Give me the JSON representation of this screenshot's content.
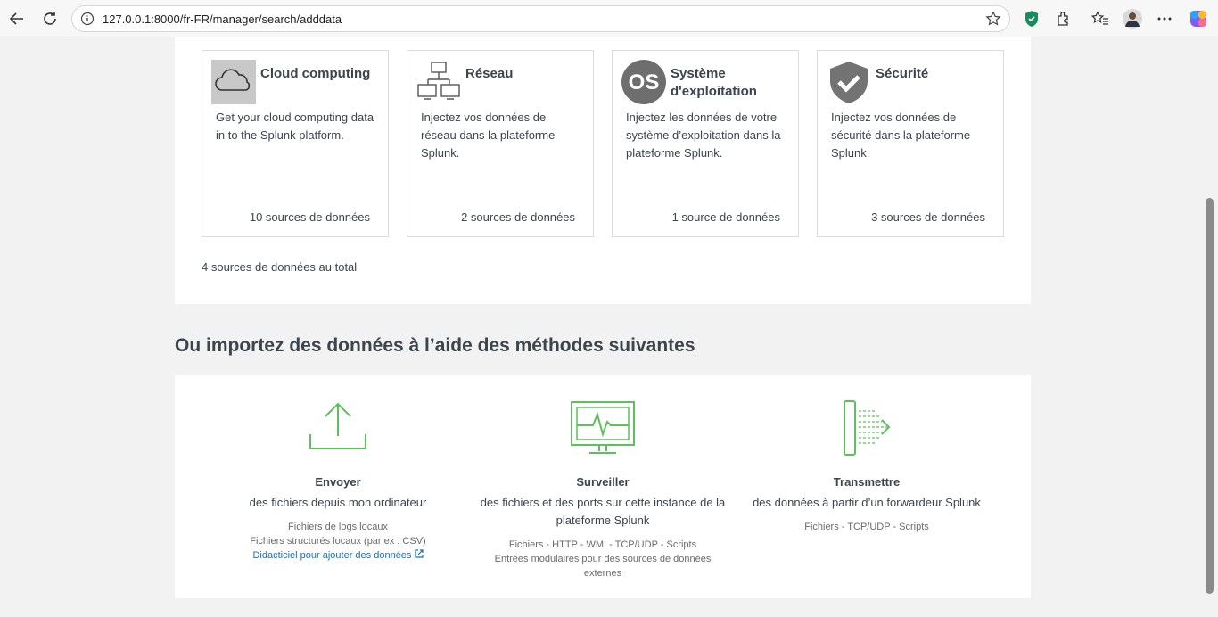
{
  "browser": {
    "url": "127.0.0.1:8000/fr-FR/manager/search/adddata"
  },
  "categories": [
    {
      "title": "Cloud computing",
      "description": "Get your cloud computing data in to the Splunk platform.",
      "count": "10 sources de données"
    },
    {
      "title": "Réseau",
      "description": "Injectez vos données de réseau dans la plateforme Splunk.",
      "count": "2 sources de données"
    },
    {
      "title": "Système d'exploitation",
      "description": "Injectez les données de votre système d’exploitation dans la plateforme Splunk.",
      "count": "1 source de données",
      "icon_text": "OS"
    },
    {
      "title": "Sécurité",
      "description": "Injectez vos données de sécurité dans la plateforme Splunk.",
      "count": "3 sources de données"
    }
  ],
  "total_sources": "4 sources de données au total",
  "section_title": "Ou importez des données à l’aide des méthodes suivantes",
  "methods": [
    {
      "title": "Envoyer",
      "description": "des fichiers depuis mon ordinateur",
      "details": [
        "Fichiers de logs locaux",
        "Fichiers structurés locaux (par ex : CSV)"
      ],
      "link": "Didacticiel pour ajouter des données"
    },
    {
      "title": "Surveiller",
      "description": "des fichiers et des ports sur cette instance de la plateforme Splunk",
      "details": [
        "Fichiers - HTTP - WMI - TCP/UDP - Scripts",
        "Entrées modulaires pour des sources de données externes"
      ]
    },
    {
      "title": "Transmettre",
      "description": "des données à partir d’un forwardeur Splunk",
      "details": [
        "Fichiers - TCP/UDP - Scripts"
      ]
    }
  ],
  "colors": {
    "accent_green": "#5cc05c",
    "link_blue": "#1a6fb5",
    "text": "#3c444d"
  }
}
